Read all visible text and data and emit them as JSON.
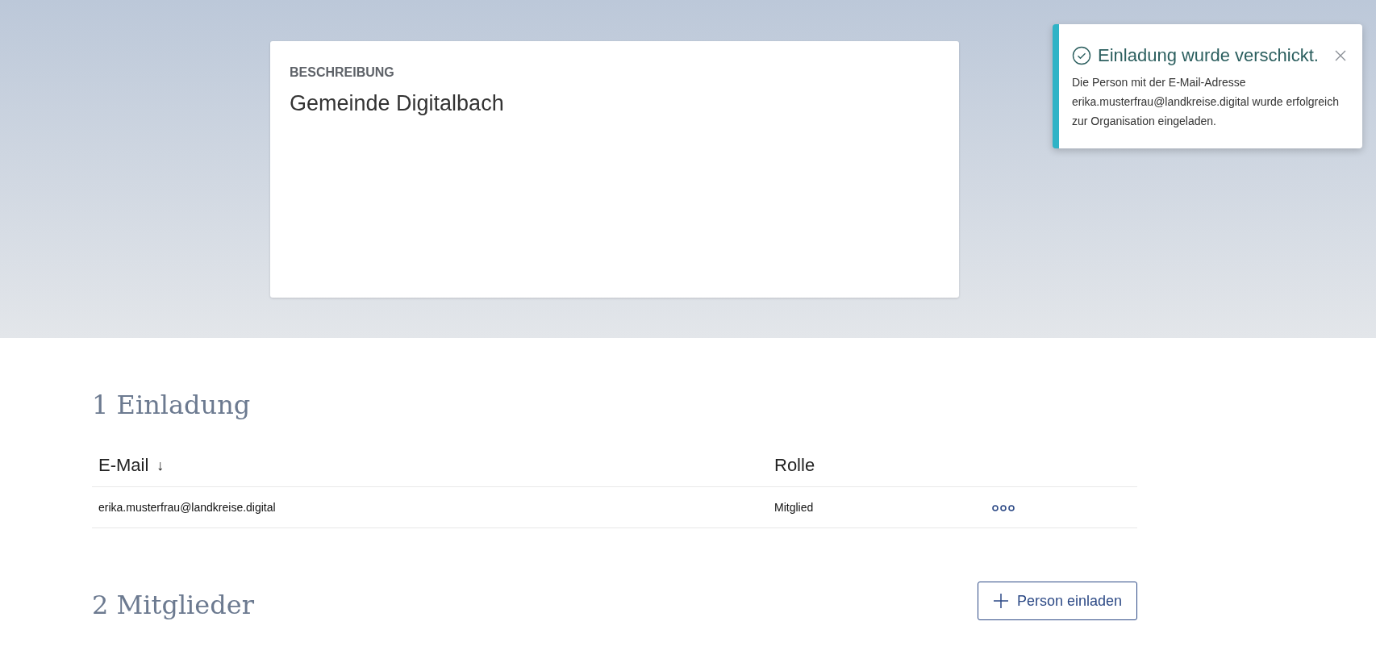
{
  "description_card": {
    "label": "BESCHREIBUNG",
    "value": "Gemeinde Digitalbach"
  },
  "toast": {
    "title": "Einladung wurde verschickt.",
    "message": "Die Person mit der E-Mail-Adresse erika.musterfrau@landkreise.digital wurde erfolgreich zur Organisation eingeladen."
  },
  "invitations": {
    "heading": "1 Einladung",
    "columns": [
      {
        "label": "E-Mail",
        "sort_indicator": "↓"
      },
      {
        "label": "Rolle"
      }
    ],
    "rows": [
      {
        "email": "erika.musterfrau@landkreise.digital",
        "role": "Mitglied"
      }
    ]
  },
  "members": {
    "heading": "2 Mitglieder",
    "invite_button": "Person einladen"
  }
}
